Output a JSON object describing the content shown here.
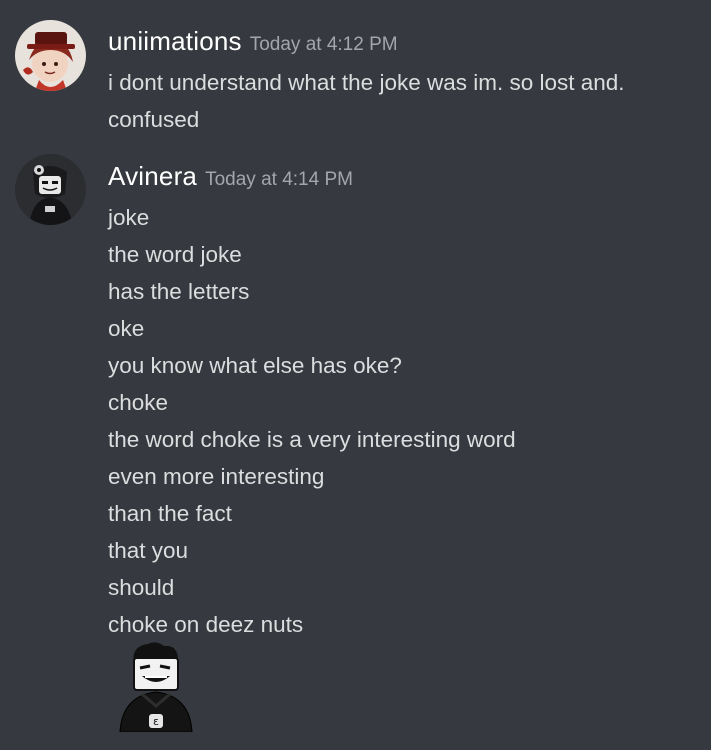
{
  "messages": [
    {
      "author": "uniimations",
      "timestamp": "Today at 4:12 PM",
      "avatar": "red-hat-character-avatar",
      "lines": [
        "i dont understand what the joke was im. so lost and.",
        "confused"
      ]
    },
    {
      "author": "Avinera",
      "timestamp": "Today at 4:14 PM",
      "avatar": "dark-character-avatar",
      "lines": [
        "joke",
        "the word joke",
        "has the letters",
        "oke",
        "you know what else has oke?",
        "choke",
        "the word choke is a very interesting word",
        "even more interesting",
        "than the fact",
        "that you",
        "should",
        "choke on deez nuts"
      ],
      "sticker": "grinning-character-sticker"
    }
  ],
  "colors": {
    "background": "#36393f",
    "text": "#dcddde",
    "username": "#ffffff",
    "timestamp": "#a3a6aa"
  }
}
